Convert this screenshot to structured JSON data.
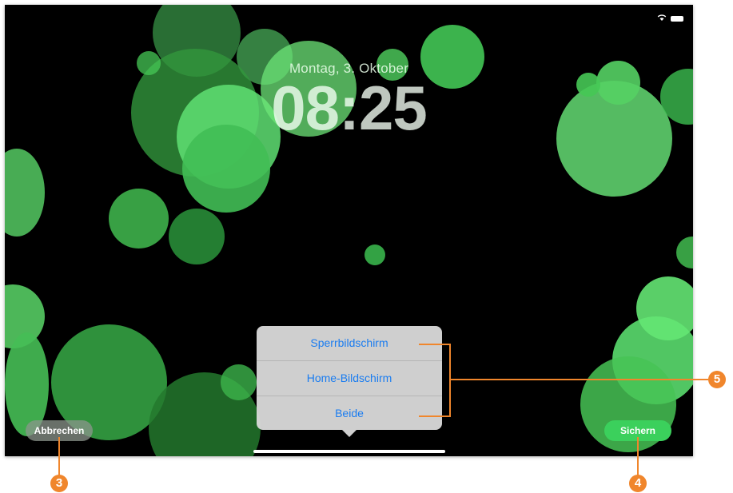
{
  "lock_screen": {
    "date": "Montag, 3. Oktober",
    "time": "08:25"
  },
  "status_bar": {
    "icons": [
      "wifi-icon",
      "battery-icon"
    ]
  },
  "buttons": {
    "cancel_label": "Abbrechen",
    "save_label": "Sichern"
  },
  "popover": {
    "options": [
      "Sperrbildschirm",
      "Home-Bildschirm",
      "Beide"
    ]
  },
  "annotations": {
    "cancel_marker": "3",
    "save_marker": "4",
    "options_marker": "5"
  },
  "colors": {
    "accent_blue": "#1a7cf0",
    "save_green": "#3bd05c",
    "callout_orange": "#f0862c",
    "bubble_greens": [
      "#2f9a3c",
      "#3dbf55",
      "#52d96a",
      "#6ce77f"
    ]
  }
}
